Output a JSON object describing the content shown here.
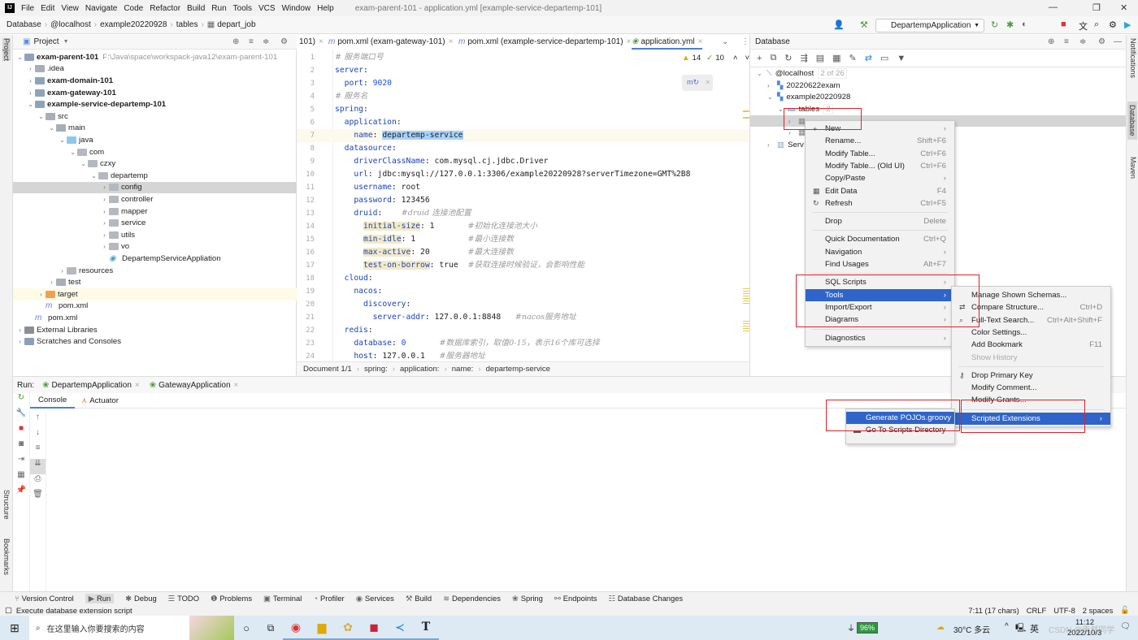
{
  "menubar": {
    "items": [
      "File",
      "Edit",
      "View",
      "Navigate",
      "Code",
      "Refactor",
      "Build",
      "Run",
      "Tools",
      "VCS",
      "Window",
      "Help"
    ],
    "title": "exam-parent-101 - application.yml [example-service-departemp-101]"
  },
  "navbar": {
    "crumbs": [
      "Database",
      "@localhost",
      "example20220928",
      "tables",
      "depart_job"
    ],
    "run_config": "DepartempApplication"
  },
  "project": {
    "header": "Project",
    "stripe_label": "Project",
    "tree": [
      {
        "label": "exam-parent-101",
        "depth": 0,
        "arrow": "v",
        "icon": "module",
        "bold": true,
        "hint": "F:\\Java\\space\\workspack-java12\\exam-parent-101"
      },
      {
        "label": ".idea",
        "depth": 1,
        "arrow": ">",
        "icon": "folder"
      },
      {
        "label": "exam-domain-101",
        "depth": 1,
        "arrow": ">",
        "icon": "module",
        "bold": true
      },
      {
        "label": "exam-gateway-101",
        "depth": 1,
        "arrow": ">",
        "icon": "module",
        "bold": true
      },
      {
        "label": "example-service-departemp-101",
        "depth": 1,
        "arrow": "v",
        "icon": "module",
        "bold": true
      },
      {
        "label": "src",
        "depth": 2,
        "arrow": "v",
        "icon": "folder"
      },
      {
        "label": "main",
        "depth": 3,
        "arrow": "v",
        "icon": "folder"
      },
      {
        "label": "java",
        "depth": 4,
        "arrow": "v",
        "icon": "source"
      },
      {
        "label": "com",
        "depth": 5,
        "arrow": "v",
        "icon": "package"
      },
      {
        "label": "czxy",
        "depth": 6,
        "arrow": "v",
        "icon": "package"
      },
      {
        "label": "departemp",
        "depth": 7,
        "arrow": "v",
        "icon": "package"
      },
      {
        "label": "config",
        "depth": 8,
        "arrow": ">",
        "icon": "package",
        "selected": true
      },
      {
        "label": "controller",
        "depth": 8,
        "arrow": ">",
        "icon": "package"
      },
      {
        "label": "mapper",
        "depth": 8,
        "arrow": ">",
        "icon": "package"
      },
      {
        "label": "service",
        "depth": 8,
        "arrow": ">",
        "icon": "package"
      },
      {
        "label": "utils",
        "depth": 8,
        "arrow": ">",
        "icon": "package"
      },
      {
        "label": "vo",
        "depth": 8,
        "arrow": ">",
        "icon": "package"
      },
      {
        "label": "DepartempServiceAppliation",
        "depth": 8,
        "arrow": "",
        "icon": "spring-class"
      },
      {
        "label": "resources",
        "depth": 4,
        "arrow": ">",
        "icon": "resources"
      },
      {
        "label": "test",
        "depth": 3,
        "arrow": ">",
        "icon": "folder"
      },
      {
        "label": "target",
        "depth": 2,
        "arrow": ">",
        "icon": "target",
        "excluded": true
      },
      {
        "label": "pom.xml",
        "depth": 2,
        "arrow": "",
        "icon": "maven"
      },
      {
        "label": "pom.xml",
        "depth": 1,
        "arrow": "",
        "icon": "maven"
      },
      {
        "label": "External Libraries",
        "depth": 0,
        "arrow": ">",
        "icon": "libraries"
      },
      {
        "label": "Scratches and Consoles",
        "depth": 0,
        "arrow": ">",
        "icon": "scratches"
      }
    ]
  },
  "editor": {
    "tabs": [
      {
        "label": "101)",
        "icon": ""
      },
      {
        "label": "pom.xml (exam-gateway-101)",
        "icon": "maven"
      },
      {
        "label": "pom.xml (example-service-departemp-101)",
        "icon": "maven"
      },
      {
        "label": "application.yml",
        "icon": "spring",
        "active": true
      }
    ],
    "warnings": "14",
    "checks": "10",
    "lines": [
      [
        [
          "c",
          "# 服务端口号"
        ]
      ],
      [
        [
          "k",
          "server"
        ],
        [
          "v",
          ":"
        ]
      ],
      [
        [
          "k",
          "  port"
        ],
        [
          "v",
          ": "
        ],
        [
          "n",
          "9020"
        ]
      ],
      [
        [
          "c",
          "# 服务名"
        ]
      ],
      [
        [
          "k",
          "spring"
        ],
        [
          "v",
          ":"
        ]
      ],
      [
        [
          "k",
          "  application"
        ],
        [
          "v",
          ":"
        ]
      ],
      [
        [
          "k",
          "    name"
        ],
        [
          "v",
          ": "
        ],
        [
          "sel",
          "departemp-service"
        ]
      ],
      [
        [
          "k",
          "  datasource"
        ],
        [
          "v",
          ":"
        ]
      ],
      [
        [
          "k",
          "    driverClassName"
        ],
        [
          "v",
          ": com.mysql.cj.jdbc.Driver"
        ]
      ],
      [
        [
          "k",
          "    url"
        ],
        [
          "v",
          ": jdbc:mysql://127.0.0.1:3306/example20220928?serverTimezone=GMT%2B8"
        ]
      ],
      [
        [
          "k",
          "    username"
        ],
        [
          "v",
          ": root"
        ]
      ],
      [
        [
          "k",
          "    password"
        ],
        [
          "v",
          ": 123456"
        ]
      ],
      [
        [
          "k",
          "    druid"
        ],
        [
          "v",
          ":    "
        ],
        [
          "c",
          "#druid 连接池配置"
        ]
      ],
      [
        [
          "v",
          "      "
        ],
        [
          "hk",
          "initial-size"
        ],
        [
          "v",
          ": 1       "
        ],
        [
          "c",
          "#初始化连接池大小"
        ]
      ],
      [
        [
          "v",
          "      "
        ],
        [
          "hk",
          "min-idle"
        ],
        [
          "v",
          ": 1           "
        ],
        [
          "c",
          "#最小连接数"
        ]
      ],
      [
        [
          "v",
          "      "
        ],
        [
          "hk",
          "max-active"
        ],
        [
          "v",
          ": 20        "
        ],
        [
          "c",
          "#最大连接数"
        ]
      ],
      [
        [
          "v",
          "      "
        ],
        [
          "hk",
          "test-on-borrow"
        ],
        [
          "v",
          ": true  "
        ],
        [
          "c",
          "#获取连接时候验证，会影响性能"
        ]
      ],
      [
        [
          "k",
          "  cloud"
        ],
        [
          "v",
          ":"
        ]
      ],
      [
        [
          "k",
          "    nacos"
        ],
        [
          "v",
          ":"
        ]
      ],
      [
        [
          "k",
          "      discovery"
        ],
        [
          "v",
          ":"
        ]
      ],
      [
        [
          "k",
          "        server-addr"
        ],
        [
          "v",
          ": 127.0.0.1:8848   "
        ],
        [
          "c",
          "#nacos服务地址"
        ]
      ],
      [
        [
          "k",
          "  redis"
        ],
        [
          "v",
          ":"
        ]
      ],
      [
        [
          "k",
          "    database"
        ],
        [
          "v",
          ": "
        ],
        [
          "n",
          "0"
        ],
        [
          "v",
          "       "
        ],
        [
          "c",
          "#数据库索引，取值0-15，表示16个库可选择"
        ]
      ],
      [
        [
          "k",
          "    host"
        ],
        [
          "v",
          ": 127.0.0.1   "
        ],
        [
          "c",
          "#服务器地址"
        ]
      ]
    ],
    "current_line": 7,
    "breadcrumb": [
      "Document 1/1",
      "spring:",
      "application:",
      "name:",
      "departemp-service"
    ]
  },
  "database": {
    "header": "Database",
    "tree": [
      {
        "label": "@localhost",
        "depth": 0,
        "arrow": "v",
        "hint": "2 of 26"
      },
      {
        "label": "20220622exam",
        "depth": 1,
        "arrow": ">"
      },
      {
        "label": "example20220928",
        "depth": 1,
        "arrow": "v"
      },
      {
        "label": "tables",
        "depth": 2,
        "arrow": "v",
        "hint": "2"
      },
      {
        "label": "",
        "depth": 3,
        "arrow": ">",
        "selected": true
      },
      {
        "label": "",
        "depth": 3,
        "arrow": ">"
      },
      {
        "label": "Serv",
        "depth": 1,
        "arrow": ">"
      }
    ]
  },
  "context_menu": {
    "items": [
      {
        "label": "New",
        "sub": true,
        "icon": "+"
      },
      {
        "label": "Rename...",
        "shortcut": "Shift+F6"
      },
      {
        "label": "Modify Table...",
        "shortcut": "Ctrl+F6"
      },
      {
        "label": "Modify Table... (Old UI)",
        "shortcut": "Ctrl+F6"
      },
      {
        "label": "Copy/Paste",
        "sub": true
      },
      {
        "label": "Edit Data",
        "shortcut": "F4",
        "icon": "▦"
      },
      {
        "label": "Refresh",
        "shortcut": "Ctrl+F5",
        "icon": "↻"
      },
      {
        "sep": true
      },
      {
        "label": "Drop",
        "shortcut": "Delete"
      },
      {
        "sep": true
      },
      {
        "label": "Quick Documentation",
        "shortcut": "Ctrl+Q"
      },
      {
        "label": "Navigation",
        "sub": true
      },
      {
        "label": "Find Usages",
        "shortcut": "Alt+F7"
      },
      {
        "sep": true
      },
      {
        "label": "SQL Scripts",
        "sub": true
      },
      {
        "label": "Tools",
        "sub": true,
        "highlighted": true
      },
      {
        "label": "Import/Export",
        "sub": true
      },
      {
        "label": "Diagrams",
        "sub": true
      },
      {
        "sep": true
      },
      {
        "label": "Diagnostics",
        "sub": true
      }
    ]
  },
  "tools_menu": {
    "items": [
      {
        "label": "Manage Shown Schemas..."
      },
      {
        "label": "Compare Structure...",
        "shortcut": "Ctrl+D",
        "icon": "⇄"
      },
      {
        "label": "Full-Text Search...",
        "shortcut": "Ctrl+Alt+Shift+F",
        "icon": "⌕"
      },
      {
        "label": "Color Settings..."
      },
      {
        "label": "Add Bookmark",
        "shortcut": "F11"
      },
      {
        "label": "Show History",
        "disabled": true
      },
      {
        "sep": true
      },
      {
        "label": "Drop Primary Key",
        "icon": "⚷"
      },
      {
        "label": "Modify Comment..."
      },
      {
        "label": "Modify Grants..."
      },
      {
        "sep": true
      },
      {
        "label": "Scripted Extensions",
        "sub": true,
        "highlighted": true
      }
    ]
  },
  "scripts_menu": {
    "items": [
      {
        "label": "Generate POJOs.groovy",
        "highlighted": true
      },
      {
        "label": "Go To Scripts Directory",
        "icon": "▬"
      }
    ]
  },
  "right_stripe": [
    "Notifications",
    "Database",
    "Maven"
  ],
  "left_stripe": [
    "Structure",
    "Bookmarks"
  ],
  "run": {
    "label": "Run:",
    "tabs": [
      "DepartempApplication",
      "GatewayApplication"
    ],
    "subtabs": [
      "Console",
      "Actuator"
    ]
  },
  "toolwindows": [
    "Version Control",
    "Run",
    "Debug",
    "TODO",
    "Problems",
    "Terminal",
    "Profiler",
    "Services",
    "Build",
    "Dependencies",
    "Spring",
    "Endpoints",
    "Database Changes"
  ],
  "status": {
    "message": "Execute database extension script",
    "position": "7:11 (17 chars)",
    "line_sep": "CRLF",
    "encoding": "UTF-8",
    "indent": "2 spaces"
  },
  "taskbar": {
    "search_placeholder": "在这里输入你要搜索的内容",
    "battery": "96%",
    "weather": "30°C 多云",
    "ime": "英",
    "time": "11:12",
    "date": "2022/10/3",
    "watermark": "CSDN @南然同学"
  },
  "colors": {
    "accent": "#2f65ca",
    "highlight_box": "#e0202a",
    "selection": "#a6d2ff"
  }
}
